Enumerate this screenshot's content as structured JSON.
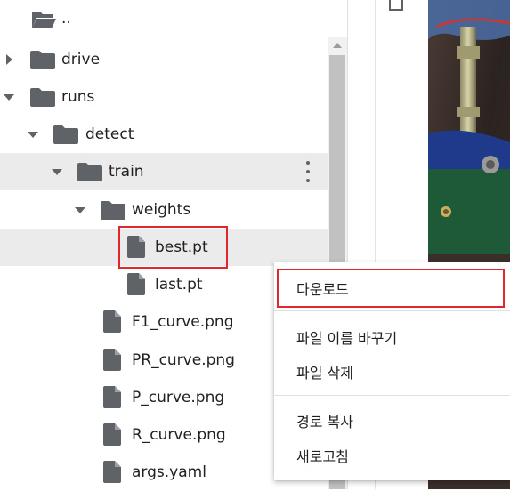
{
  "tree": {
    "rows": [
      {
        "name": "..",
        "icon": "folder-open-icon",
        "caret": "none"
      },
      {
        "name": "drive",
        "icon": "folder-icon",
        "caret": "right"
      },
      {
        "name": "runs",
        "icon": "folder-icon",
        "caret": "down"
      },
      {
        "name": "detect",
        "icon": "folder-icon",
        "caret": "down"
      },
      {
        "name": "train",
        "icon": "folder-icon",
        "caret": "down"
      },
      {
        "name": "weights",
        "icon": "folder-icon",
        "caret": "down"
      },
      {
        "name": "best.pt",
        "icon": "file-icon",
        "caret": "none"
      },
      {
        "name": "last.pt",
        "icon": "file-icon",
        "caret": "none"
      },
      {
        "name": "F1_curve.png",
        "icon": "file-icon",
        "caret": "none"
      },
      {
        "name": "PR_curve.png",
        "icon": "file-icon",
        "caret": "none"
      },
      {
        "name": "P_curve.png",
        "icon": "file-icon",
        "caret": "none"
      },
      {
        "name": "R_curve.png",
        "icon": "file-icon",
        "caret": "none"
      },
      {
        "name": "args.yaml",
        "icon": "file-icon",
        "caret": "none"
      }
    ]
  },
  "context_menu": {
    "download": "다운로드",
    "rename": "파일 이름 바꾸기",
    "delete": "파일 삭제",
    "copy_path": "경로 복사",
    "refresh": "새로고침"
  },
  "colors": {
    "highlight_box": "#e0272d",
    "hover_row": "#ebebeb",
    "icon": "#5f6368"
  }
}
